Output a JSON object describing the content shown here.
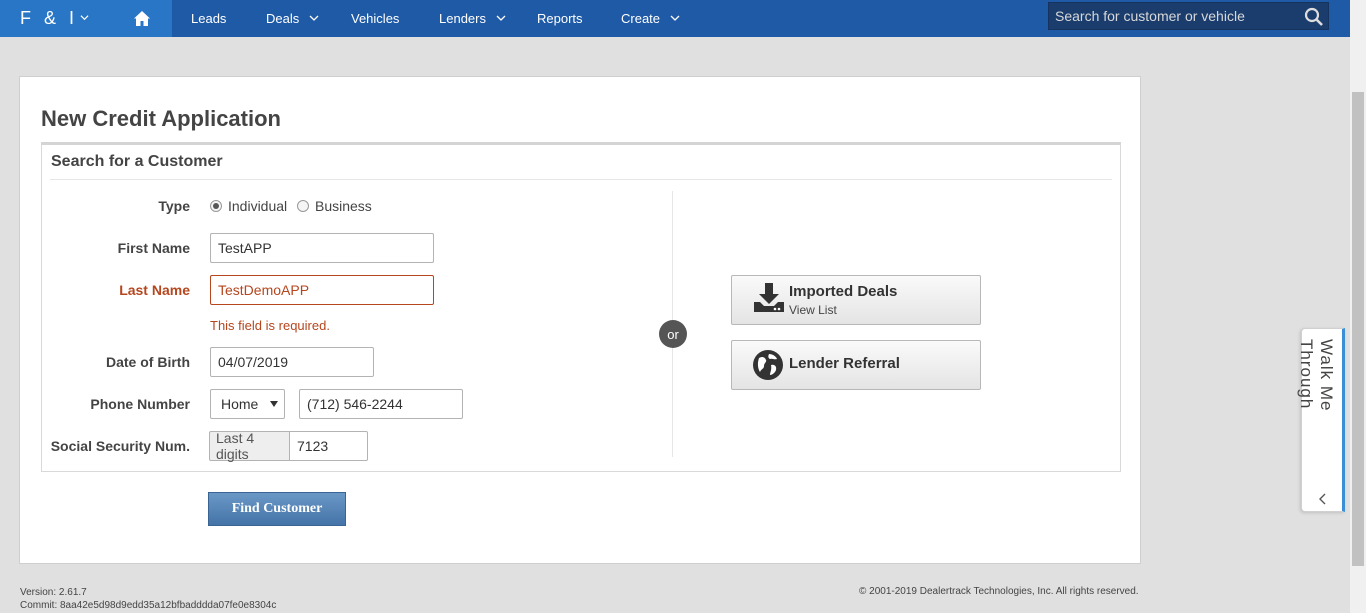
{
  "nav": {
    "brand": "F & I",
    "items": [
      {
        "label": "Leads",
        "dropdown": false
      },
      {
        "label": "Deals",
        "dropdown": true
      },
      {
        "label": "Vehicles",
        "dropdown": false
      },
      {
        "label": "Lenders",
        "dropdown": true
      },
      {
        "label": "Reports",
        "dropdown": false
      },
      {
        "label": "Create",
        "dropdown": true
      }
    ],
    "search_placeholder": "Search for customer or vehicle"
  },
  "page": {
    "title": "New Credit Application",
    "section_title": "Search for a Customer"
  },
  "form": {
    "type_label": "Type",
    "type_options": [
      {
        "label": "Individual",
        "checked": true
      },
      {
        "label": "Business",
        "checked": false
      }
    ],
    "first_name_label": "First Name",
    "first_name_value": "TestAPP",
    "last_name_label": "Last Name",
    "last_name_value": "TestDemoAPP",
    "last_name_error": "This field is required.",
    "dob_label": "Date of Birth",
    "dob_value": "04/07/2019",
    "phone_label": "Phone Number",
    "phone_type": "Home",
    "phone_value": "(712) 546-2244",
    "ssn_label": "Social Security Num.",
    "ssn_addon": "Last 4 digits",
    "ssn_value": "7123",
    "find_button": "Find Customer"
  },
  "or_label": "or",
  "side_buttons": {
    "imported_title": "Imported Deals",
    "imported_sub": "View List",
    "lender_title": "Lender Referral"
  },
  "footer": {
    "version": "Version: 2.61.7",
    "commit": "Commit: 8aa42e5d98d9edd35a12bfbadddda07fe0e8304c",
    "copyright": "© 2001-2019 Dealertrack Technologies, Inc. All rights reserved."
  },
  "walkme": {
    "label": "Walk Me Through"
  },
  "colors": {
    "nav_bg": "#1f5aa6",
    "nav_active": "#2a76c6",
    "error": "#b5461e",
    "primary_button": "#4f80b4"
  }
}
